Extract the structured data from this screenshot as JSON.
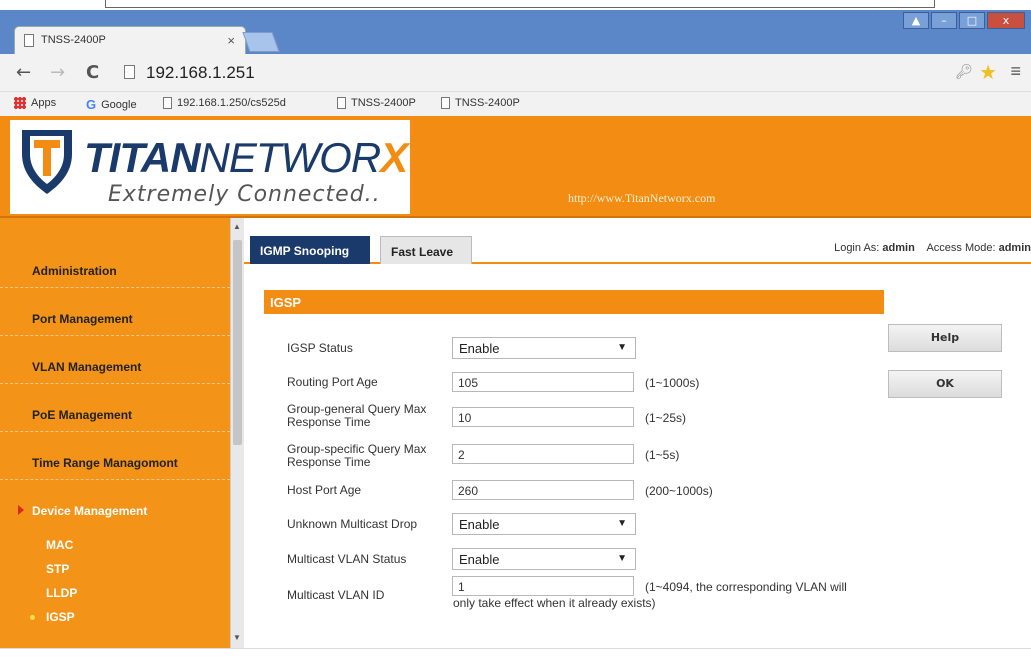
{
  "browser": {
    "tab_title": "TNSS-2400P",
    "tab_close": "×",
    "url": "192.168.1.251",
    "window_buttons": [
      "▲",
      "–",
      "□",
      "x"
    ],
    "bookmarks": [
      {
        "label": "Apps",
        "icon": "apps-grid-icon"
      },
      {
        "label": "Google",
        "icon": "google-icon"
      },
      {
        "label": "192.168.1.250/cs525d",
        "icon": "page-icon"
      },
      {
        "label": "TNSS-2400P",
        "icon": "page-icon"
      },
      {
        "label": "TNSS-2400P",
        "icon": "page-icon"
      }
    ],
    "nav": {
      "back": "←",
      "forward": "→",
      "reload": "C"
    }
  },
  "header": {
    "brand_titan": "TITAN",
    "brand_networ": "NETWOR",
    "brand_x": "X",
    "tagline": "Extremely Connected..",
    "site_url": "http://www.TitanNetworx.com",
    "brand_color": "#f28c12",
    "brand_navy": "#1a3a6b"
  },
  "sidebar": {
    "items": [
      {
        "label": "Administration"
      },
      {
        "label": "Port Management"
      },
      {
        "label": "VLAN Management"
      },
      {
        "label": "PoE Management"
      },
      {
        "label": "Time Range Managomont"
      },
      {
        "label": "Device Management"
      }
    ],
    "sub_items": [
      {
        "label": "MAC"
      },
      {
        "label": "STP"
      },
      {
        "label": "LLDP"
      },
      {
        "label": "IGSP"
      }
    ]
  },
  "content": {
    "tabs": [
      {
        "label": "IGMP Snooping",
        "active": true
      },
      {
        "label": "Fast Leave",
        "active": false
      }
    ],
    "login_label": "Login As:",
    "login_user": "admin",
    "access_label": "Access Mode:",
    "access_mode": "admin",
    "section_title": "IGSP",
    "buttons": {
      "help": "Help",
      "ok": "OK"
    },
    "fields": {
      "igsp_status": {
        "label": "IGSP Status",
        "value": "Enable"
      },
      "routing_port_age": {
        "label": "Routing Port Age",
        "value": "105",
        "hint": "(1~1000s)"
      },
      "group_general": {
        "label": "Group-general Query Max Response Time",
        "value": "10",
        "hint": "(1~25s)"
      },
      "group_specific": {
        "label": "Group-specific Query Max Response Time",
        "value": "2",
        "hint": "(1~5s)"
      },
      "host_port_age": {
        "label": "Host Port Age",
        "value": "260",
        "hint": "(200~1000s)"
      },
      "unknown_multicast_drop": {
        "label": "Unknown Multicast Drop",
        "value": "Enable"
      },
      "multicast_vlan_status": {
        "label": "Multicast VLAN Status",
        "value": "Enable"
      },
      "multicast_vlan_id": {
        "label": "Multicast VLAN ID",
        "value": "1",
        "hint_line1": "(1~4094, the corresponding VLAN will",
        "hint_line2": "only take effect when it already exists)"
      }
    },
    "select_caret": "▼"
  }
}
